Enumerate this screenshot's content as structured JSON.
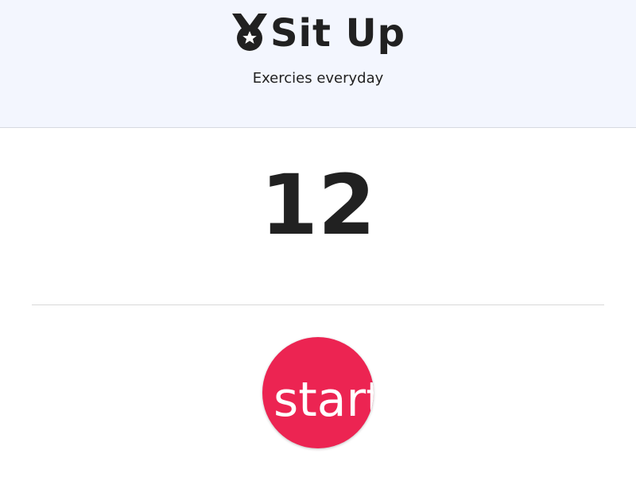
{
  "header": {
    "title": "Sit Up",
    "subtitle": "Exercies everyday",
    "icon": "medal-icon",
    "background_color": "#f3f6fe"
  },
  "counter": {
    "value": "12"
  },
  "start_button": {
    "label": "start",
    "color": "#ec2452"
  }
}
